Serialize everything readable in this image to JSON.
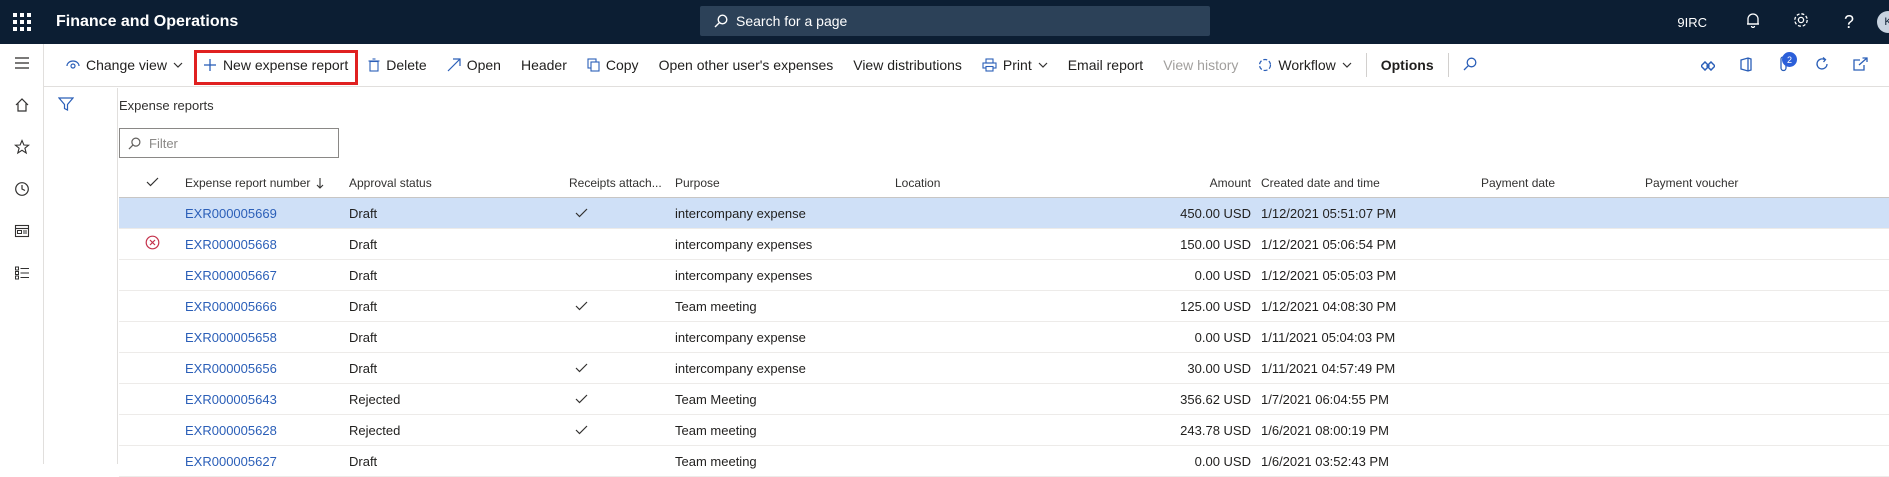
{
  "topbar": {
    "app_title": "Finance and Operations",
    "search_placeholder": "Search for a page",
    "company": "9IRC",
    "avatar_initial": "K"
  },
  "actions": {
    "change_view": "Change view",
    "new_expense_report": "New expense report",
    "delete": "Delete",
    "open": "Open",
    "header": "Header",
    "copy": "Copy",
    "open_other_users": "Open other user's expenses",
    "view_distributions": "View distributions",
    "print": "Print",
    "email_report": "Email report",
    "view_history": "View history",
    "workflow": "Workflow",
    "options": "Options",
    "notification_count": "2"
  },
  "page": {
    "caption": "Expense reports",
    "filter_placeholder": "Filter"
  },
  "grid": {
    "columns": {
      "number": "Expense report number",
      "status": "Approval status",
      "receipts": "Receipts attach...",
      "purpose": "Purpose",
      "location": "Location",
      "amount": "Amount",
      "created": "Created date and time",
      "payment_date": "Payment date",
      "payment_voucher": "Payment voucher"
    },
    "rows": [
      {
        "number": "EXR000005669",
        "status": "Draft",
        "receipts": true,
        "purpose": "intercompany expense",
        "location": "",
        "amount": "450.00 USD",
        "created": "1/12/2021 05:51:07 PM",
        "payment_date": "",
        "payment_voucher": "",
        "error": false
      },
      {
        "number": "EXR000005668",
        "status": "Draft",
        "receipts": false,
        "purpose": "intercompany expenses",
        "location": "",
        "amount": "150.00 USD",
        "created": "1/12/2021 05:06:54 PM",
        "payment_date": "",
        "payment_voucher": "",
        "error": true
      },
      {
        "number": "EXR000005667",
        "status": "Draft",
        "receipts": false,
        "purpose": "intercompany expenses",
        "location": "",
        "amount": "0.00 USD",
        "created": "1/12/2021 05:05:03 PM",
        "payment_date": "",
        "payment_voucher": "",
        "error": false
      },
      {
        "number": "EXR000005666",
        "status": "Draft",
        "receipts": true,
        "purpose": "Team meeting",
        "location": "",
        "amount": "125.00 USD",
        "created": "1/12/2021 04:08:30 PM",
        "payment_date": "",
        "payment_voucher": "",
        "error": false
      },
      {
        "number": "EXR000005658",
        "status": "Draft",
        "receipts": false,
        "purpose": "intercompany expense",
        "location": "",
        "amount": "0.00 USD",
        "created": "1/11/2021 05:04:03 PM",
        "payment_date": "",
        "payment_voucher": "",
        "error": false
      },
      {
        "number": "EXR000005656",
        "status": "Draft",
        "receipts": true,
        "purpose": "intercompany expense",
        "location": "",
        "amount": "30.00 USD",
        "created": "1/11/2021 04:57:49 PM",
        "payment_date": "",
        "payment_voucher": "",
        "error": false
      },
      {
        "number": "EXR000005643",
        "status": "Rejected",
        "receipts": true,
        "purpose": "Team Meeting",
        "location": "",
        "amount": "356.62 USD",
        "created": "1/7/2021 06:04:55 PM",
        "payment_date": "",
        "payment_voucher": "",
        "error": false
      },
      {
        "number": "EXR000005628",
        "status": "Rejected",
        "receipts": true,
        "purpose": "Team meeting",
        "location": "",
        "amount": "243.78 USD",
        "created": "1/6/2021 08:00:19 PM",
        "payment_date": "",
        "payment_voucher": "",
        "error": false
      },
      {
        "number": "EXR000005627",
        "status": "Draft",
        "receipts": false,
        "purpose": "Team meeting",
        "location": "",
        "amount": "0.00 USD",
        "created": "1/6/2021 03:52:43 PM",
        "payment_date": "",
        "payment_voucher": "",
        "error": false
      }
    ]
  },
  "colors": {
    "topbar_bg": "#0c1e33",
    "selected_row": "#cfe0f7",
    "link": "#2b5fb8",
    "highlight_border": "#e02020"
  }
}
